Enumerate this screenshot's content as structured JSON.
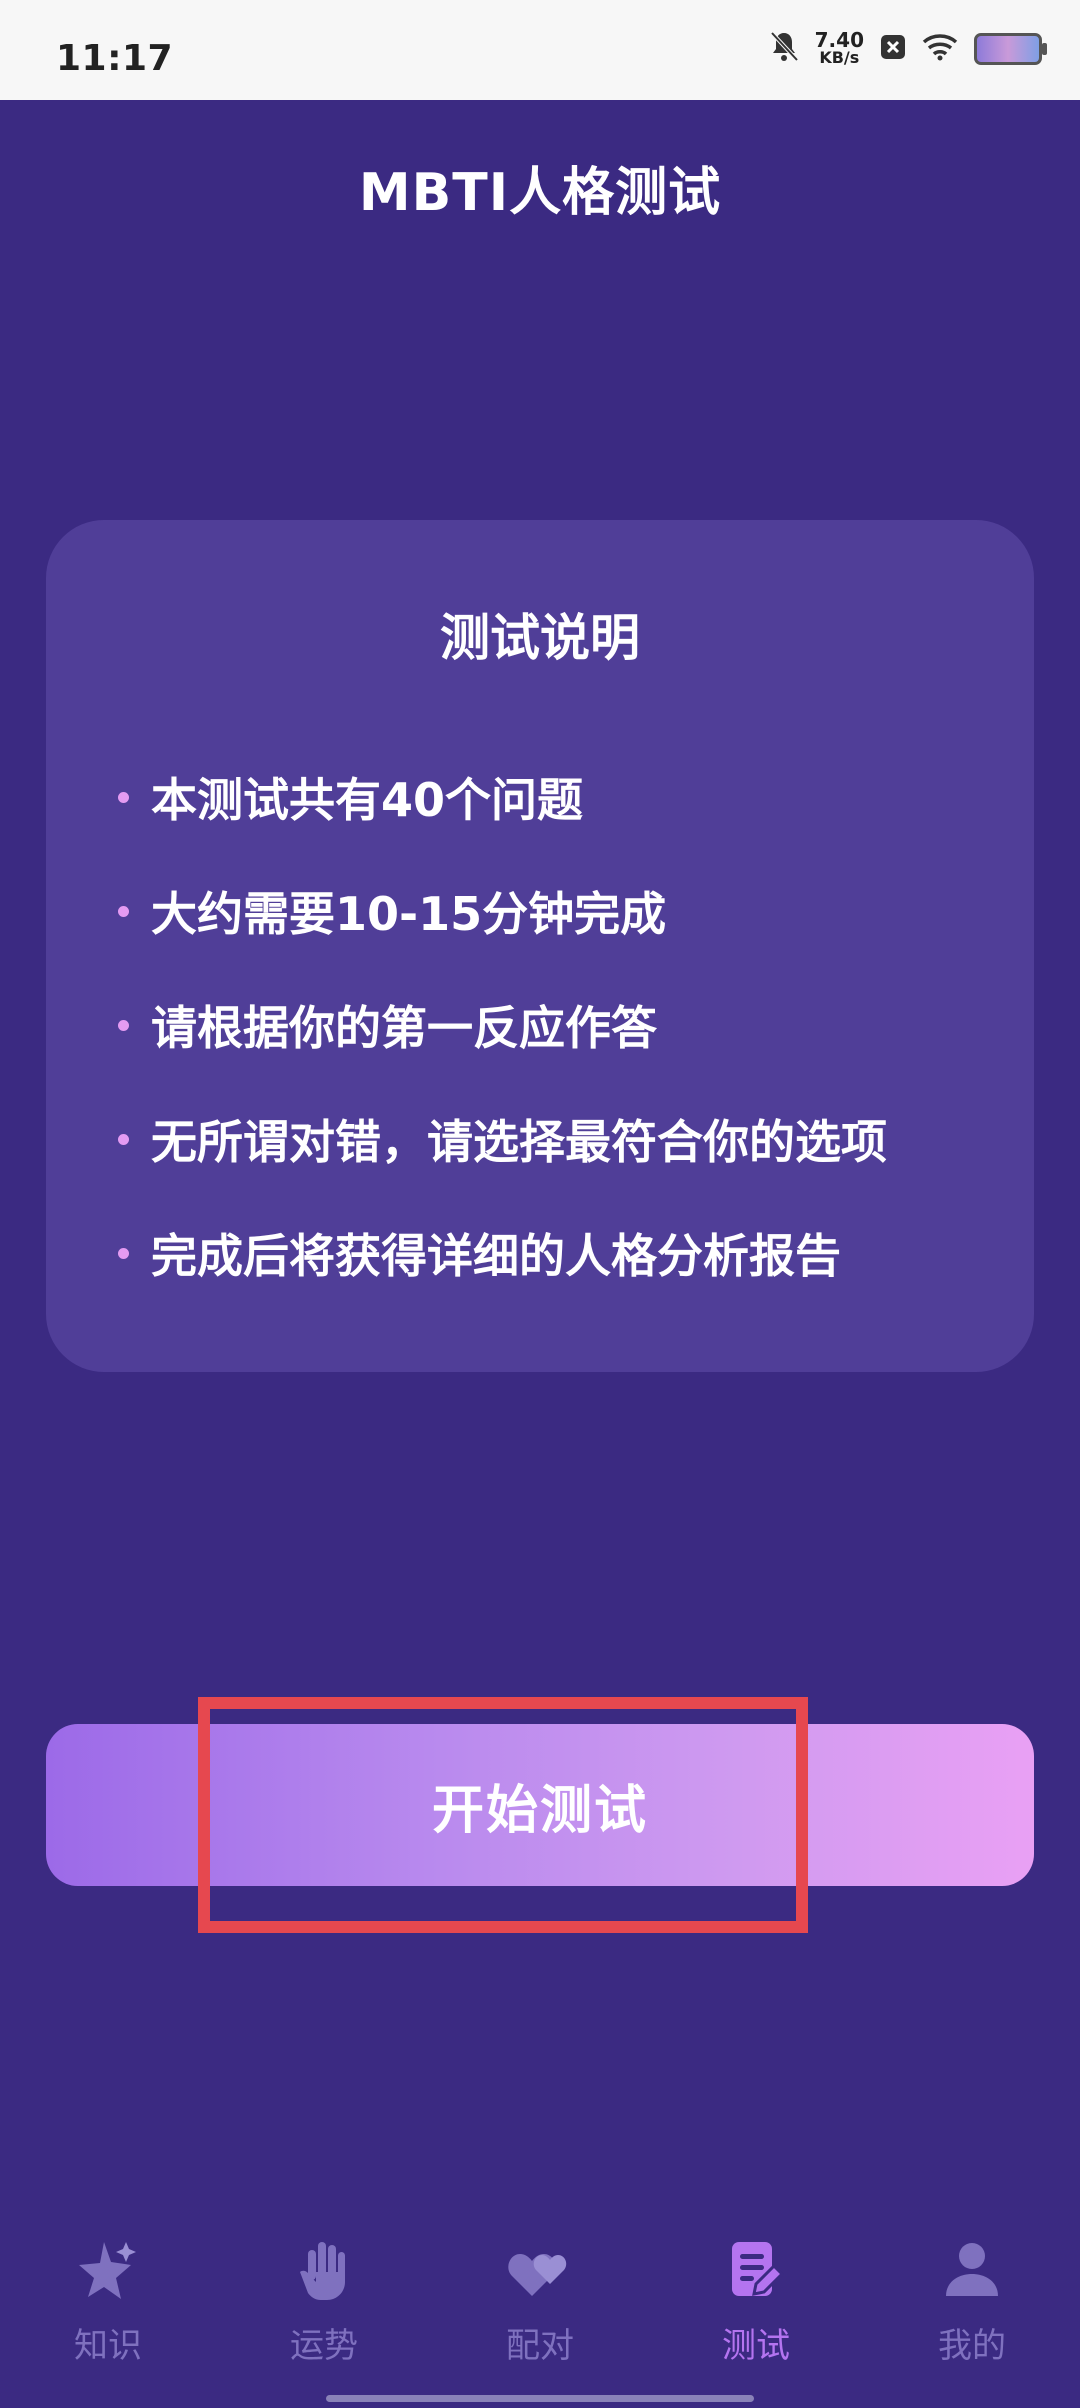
{
  "status_bar": {
    "time": "11:17",
    "net_speed_value": "7.40",
    "net_speed_unit": "KB/s",
    "icons": [
      "bell-mute-icon",
      "close-badge-icon",
      "wifi-icon",
      "battery-icon"
    ]
  },
  "header": {
    "title": "MBTI人格测试"
  },
  "info_card": {
    "title": "测试说明",
    "items": [
      "本测试共有40个问题",
      "大约需要10-15分钟完成",
      "请根据你的第一反应作答",
      "无所谓对错，请选择最符合你的选项",
      "完成后将获得详细的人格分析报告"
    ]
  },
  "start_button": {
    "label": "开始测试"
  },
  "bottom_nav": {
    "active_index": 3,
    "items": [
      {
        "label": "知识",
        "icon": "sparkle-star-icon"
      },
      {
        "label": "运势",
        "icon": "hand-palm-icon"
      },
      {
        "label": "配对",
        "icon": "hearts-icon"
      },
      {
        "label": "测试",
        "icon": "document-edit-icon"
      },
      {
        "label": "我的",
        "icon": "user-icon"
      }
    ]
  },
  "colors": {
    "background": "#3b2a82",
    "card": "#503e98",
    "accent": "#b474f0",
    "bullet": "#e49bf2",
    "nav_inactive": "#7f71bf"
  }
}
